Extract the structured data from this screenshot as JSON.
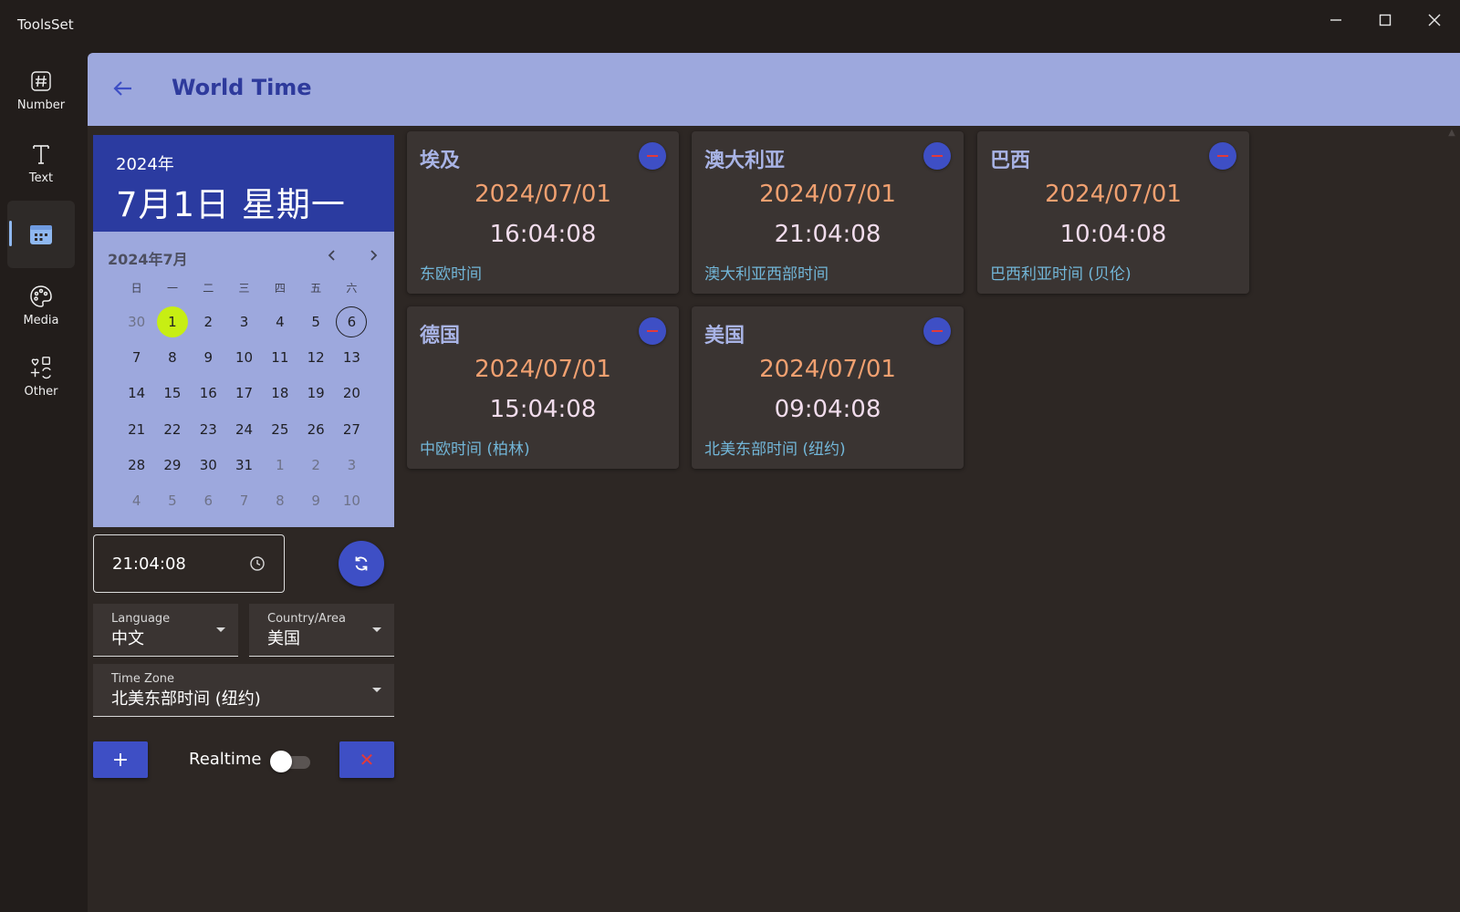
{
  "app": {
    "title": "ToolsSet"
  },
  "nav": {
    "items": [
      {
        "label": "Number",
        "icon": "hash-icon"
      },
      {
        "label": "Text",
        "icon": "text-icon"
      },
      {
        "label": "",
        "icon": "calendar-icon",
        "active": true
      },
      {
        "label": "Media",
        "icon": "palette-icon"
      },
      {
        "label": "Other",
        "icon": "shapes-icon"
      }
    ]
  },
  "header": {
    "title": "World Time"
  },
  "picker": {
    "year": "2024年",
    "date": "7月1日 星期一",
    "month": "2024年7月",
    "weekdays": [
      "日",
      "一",
      "二",
      "三",
      "四",
      "五",
      "六"
    ],
    "days": [
      [
        "30",
        "1",
        "2",
        "3",
        "4",
        "5",
        "6"
      ],
      [
        "7",
        "8",
        "9",
        "10",
        "11",
        "12",
        "13"
      ],
      [
        "14",
        "15",
        "16",
        "17",
        "18",
        "19",
        "20"
      ],
      [
        "21",
        "22",
        "23",
        "24",
        "25",
        "26",
        "27"
      ],
      [
        "28",
        "29",
        "30",
        "31",
        "1",
        "2",
        "3"
      ],
      [
        "4",
        "5",
        "6",
        "7",
        "8",
        "9",
        "10"
      ]
    ],
    "selected_day": "1",
    "today_day": "6"
  },
  "time_field": {
    "value": "21:04:08"
  },
  "language": {
    "label": "Language",
    "value": "中文"
  },
  "country": {
    "label": "Country/Area",
    "value": "美国"
  },
  "timezone": {
    "label": "Time Zone",
    "value": "北美东部时间 (纽约)"
  },
  "controls": {
    "add_label": "+",
    "realtime_label": "Realtime",
    "realtime_on": false,
    "clear_label": "✕"
  },
  "cards": [
    {
      "country": "埃及",
      "date": "2024/07/01",
      "time": "16:04:08",
      "zone": "东欧时间"
    },
    {
      "country": "澳大利亚",
      "date": "2024/07/01",
      "time": "21:04:08",
      "zone": "澳大利亚西部时间"
    },
    {
      "country": "巴西",
      "date": "2024/07/01",
      "time": "10:04:08",
      "zone": "巴西利亚时间 (贝伦)"
    },
    {
      "country": "德国",
      "date": "2024/07/01",
      "time": "15:04:08",
      "zone": "中欧时间 (柏林)"
    },
    {
      "country": "美国",
      "date": "2024/07/01",
      "time": "09:04:08",
      "zone": "北美东部时间 (纽约)"
    }
  ],
  "colors": {
    "accent": "#3e4fc5",
    "header_bg": "#9da8dd",
    "title": "#2e3a9c",
    "date_text": "#f0a070",
    "zone_text": "#72b6d8",
    "selected_day": "#c7ee13"
  }
}
